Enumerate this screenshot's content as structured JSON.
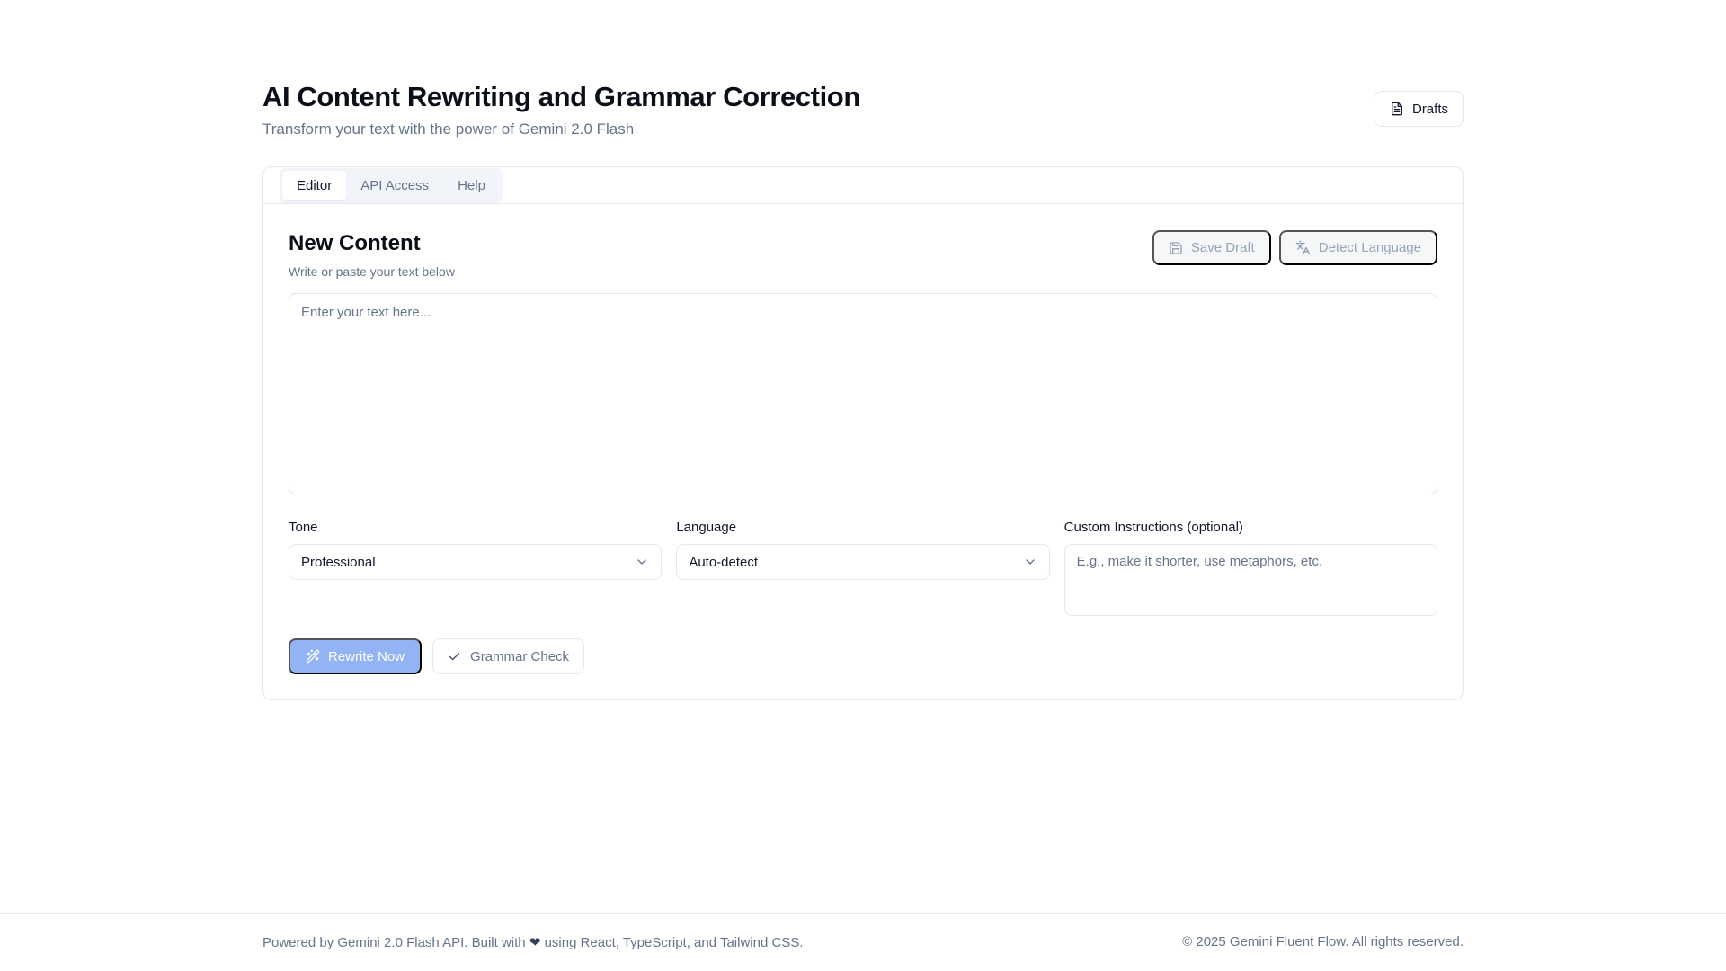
{
  "header": {
    "title": "AI Content Rewriting and Grammar Correction",
    "subtitle": "Transform your text with the power of Gemini 2.0 Flash",
    "drafts_label": "Drafts"
  },
  "tabs": [
    {
      "label": "Editor",
      "active": true
    },
    {
      "label": "API Access",
      "active": false
    },
    {
      "label": "Help",
      "active": false
    }
  ],
  "editor": {
    "title": "New Content",
    "subtitle": "Write or paste your text below",
    "save_draft_label": "Save Draft",
    "detect_language_label": "Detect Language",
    "text_placeholder": "Enter your text here...",
    "text_value": ""
  },
  "fields": {
    "tone": {
      "label": "Tone",
      "value": "Professional"
    },
    "language": {
      "label": "Language",
      "value": "Auto-detect"
    },
    "custom": {
      "label": "Custom Instructions (optional)",
      "placeholder": "E.g., make it shorter, use metaphors, etc.",
      "value": ""
    }
  },
  "actions": {
    "rewrite_label": "Rewrite Now",
    "grammar_label": "Grammar Check"
  },
  "footer": {
    "left_prefix": "Powered by Gemini 2.0 Flash API. Built with",
    "heart": "❤",
    "left_suffix": "using React, TypeScript, and Tailwind CSS.",
    "right": "© 2025 Gemini Fluent Flow. All rights reserved."
  },
  "colors": {
    "primary_disabled": "#93b4f4",
    "muted_text": "#64748b",
    "border": "#e2e8f0"
  },
  "icons": {
    "drafts": "file-text-icon",
    "save_draft": "save-icon",
    "detect_language": "languages-icon",
    "select": "chevron-down-icon",
    "rewrite": "magic-wand-icon",
    "grammar": "check-icon"
  }
}
